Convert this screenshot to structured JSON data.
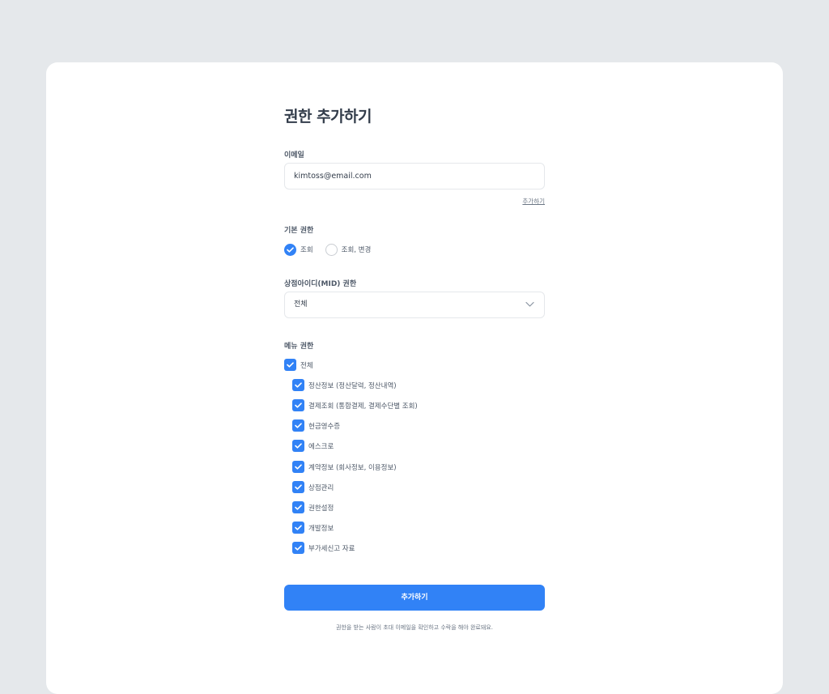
{
  "page": {
    "title": "권한 추가하기",
    "email": {
      "label": "이메일",
      "value": "kimtoss@email.com",
      "add_link": "추가하기"
    },
    "basic_permission": {
      "label": "기본 권한",
      "options": [
        {
          "label": "조회",
          "selected": true
        },
        {
          "label": "조회, 변경",
          "selected": false
        }
      ]
    },
    "mid_permission": {
      "label": "상점아이디(MID) 권한",
      "selected": "전체"
    },
    "menu_permission": {
      "label": "메뉴 권한",
      "all_label": "전체",
      "items": [
        "정산정보 (정산달력, 정산내역)",
        "결제조회 (통합결제, 결제수단별 조회)",
        "현금영수증",
        "에스크로",
        "계약정보 (회사정보, 이용정보)",
        "상점관리",
        "권한설정",
        "개발정보",
        "부가세신고 자료"
      ]
    },
    "submit_label": "추가하기",
    "note": "권한을 받는 사람이 초대 이메일을 확인하고 수락을 해야 완료돼요."
  },
  "colors": {
    "accent": "#3182f6",
    "background": "#e5e8eb",
    "card": "#ffffff"
  }
}
